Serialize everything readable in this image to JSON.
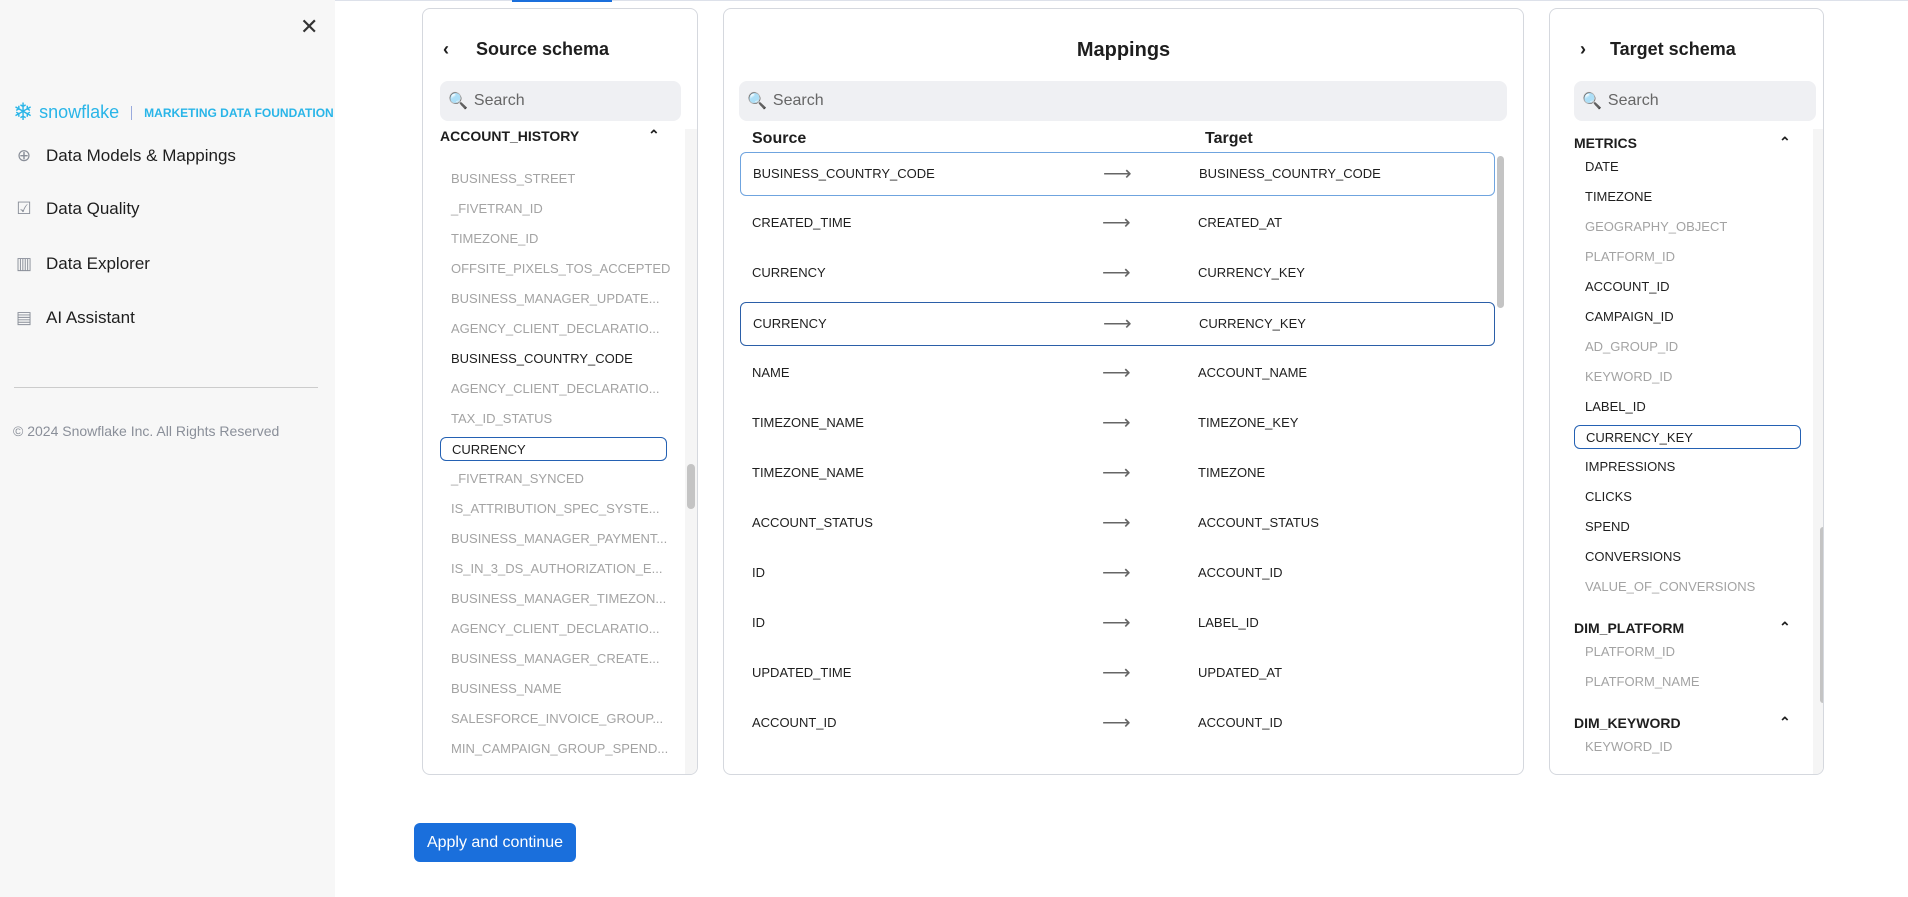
{
  "sidebar": {
    "logo": {
      "brand": "snowflake",
      "product": "MARKETING DATA FOUNDATION"
    },
    "items": [
      {
        "label": "Data Models & Mappings",
        "icon": "plus-circle-icon"
      },
      {
        "label": "Data Quality",
        "icon": "checkbox-icon"
      },
      {
        "label": "Data Explorer",
        "icon": "bar-chart-icon"
      },
      {
        "label": "AI Assistant",
        "icon": "chat-icon"
      }
    ],
    "copyright": "© 2024 Snowflake Inc. All Rights Reserved"
  },
  "source": {
    "title": "Source schema",
    "search_placeholder": "Search",
    "section": "ACCOUNT_HISTORY",
    "items": [
      {
        "label": "BUSINESS_STREET",
        "state": "dim"
      },
      {
        "label": "_FIVETRAN_ID",
        "state": "dim"
      },
      {
        "label": "TIMEZONE_ID",
        "state": "dim"
      },
      {
        "label": "OFFSITE_PIXELS_TOS_ACCEPTED",
        "state": "dim"
      },
      {
        "label": "BUSINESS_MANAGER_UPDATE...",
        "state": "dim"
      },
      {
        "label": "AGENCY_CLIENT_DECLARATIO...",
        "state": "dim"
      },
      {
        "label": "BUSINESS_COUNTRY_CODE",
        "state": "normal"
      },
      {
        "label": "AGENCY_CLIENT_DECLARATIO...",
        "state": "dim"
      },
      {
        "label": "TAX_ID_STATUS",
        "state": "dim"
      },
      {
        "label": "CURRENCY",
        "state": "selected"
      },
      {
        "label": "_FIVETRAN_SYNCED",
        "state": "dim"
      },
      {
        "label": "IS_ATTRIBUTION_SPEC_SYSTE...",
        "state": "dim"
      },
      {
        "label": "BUSINESS_MANAGER_PAYMENT...",
        "state": "dim"
      },
      {
        "label": "IS_IN_3_DS_AUTHORIZATION_E...",
        "state": "dim"
      },
      {
        "label": "BUSINESS_MANAGER_TIMEZON...",
        "state": "dim"
      },
      {
        "label": "AGENCY_CLIENT_DECLARATIO...",
        "state": "dim"
      },
      {
        "label": "BUSINESS_MANAGER_CREATE...",
        "state": "dim"
      },
      {
        "label": "BUSINESS_NAME",
        "state": "dim"
      },
      {
        "label": "SALESFORCE_INVOICE_GROUP...",
        "state": "dim"
      },
      {
        "label": "MIN_CAMPAIGN_GROUP_SPEND...",
        "state": "dim"
      }
    ]
  },
  "mappings": {
    "title": "Mappings",
    "search_placeholder": "Search",
    "source_header": "Source",
    "target_header": "Target",
    "rows": [
      {
        "source": "BUSINESS_COUNTRY_CODE",
        "target": "BUSINESS_COUNTRY_CODE",
        "state": "hover"
      },
      {
        "source": "CREATED_TIME",
        "target": "CREATED_AT"
      },
      {
        "source": "CURRENCY",
        "target": "CURRENCY_KEY"
      },
      {
        "source": "CURRENCY",
        "target": "CURRENCY_KEY",
        "state": "selected"
      },
      {
        "source": "NAME",
        "target": "ACCOUNT_NAME"
      },
      {
        "source": "TIMEZONE_NAME",
        "target": "TIMEZONE_KEY"
      },
      {
        "source": "TIMEZONE_NAME",
        "target": "TIMEZONE"
      },
      {
        "source": "ACCOUNT_STATUS",
        "target": "ACCOUNT_STATUS"
      },
      {
        "source": "ID",
        "target": "ACCOUNT_ID"
      },
      {
        "source": "ID",
        "target": "LABEL_ID"
      },
      {
        "source": "UPDATED_TIME",
        "target": "UPDATED_AT"
      },
      {
        "source": "ACCOUNT_ID",
        "target": "ACCOUNT_ID"
      }
    ]
  },
  "target": {
    "title": "Target schema",
    "search_placeholder": "Search",
    "sections": [
      {
        "name": "METRICS",
        "items": [
          {
            "label": "DATE",
            "state": "normal"
          },
          {
            "label": "TIMEZONE",
            "state": "normal"
          },
          {
            "label": "GEOGRAPHY_OBJECT",
            "state": "dim"
          },
          {
            "label": "PLATFORM_ID",
            "state": "dim"
          },
          {
            "label": "ACCOUNT_ID",
            "state": "normal"
          },
          {
            "label": "CAMPAIGN_ID",
            "state": "normal"
          },
          {
            "label": "AD_GROUP_ID",
            "state": "dim"
          },
          {
            "label": "KEYWORD_ID",
            "state": "dim"
          },
          {
            "label": "LABEL_ID",
            "state": "normal"
          },
          {
            "label": "CURRENCY_KEY",
            "state": "selected"
          },
          {
            "label": "IMPRESSIONS",
            "state": "normal"
          },
          {
            "label": "CLICKS",
            "state": "normal"
          },
          {
            "label": "SPEND",
            "state": "normal"
          },
          {
            "label": "CONVERSIONS",
            "state": "normal"
          },
          {
            "label": "VALUE_OF_CONVERSIONS",
            "state": "dim"
          }
        ]
      },
      {
        "name": "DIM_PLATFORM",
        "items": [
          {
            "label": "PLATFORM_ID",
            "state": "dim"
          },
          {
            "label": "PLATFORM_NAME",
            "state": "dim"
          }
        ]
      },
      {
        "name": "DIM_KEYWORD",
        "items": [
          {
            "label": "KEYWORD_ID",
            "state": "dim"
          }
        ]
      }
    ]
  },
  "apply_label": "Apply and continue",
  "colors": {
    "accent": "#1a6fdc",
    "brand": "#29b5e8",
    "selected_border": "#2461b3"
  }
}
